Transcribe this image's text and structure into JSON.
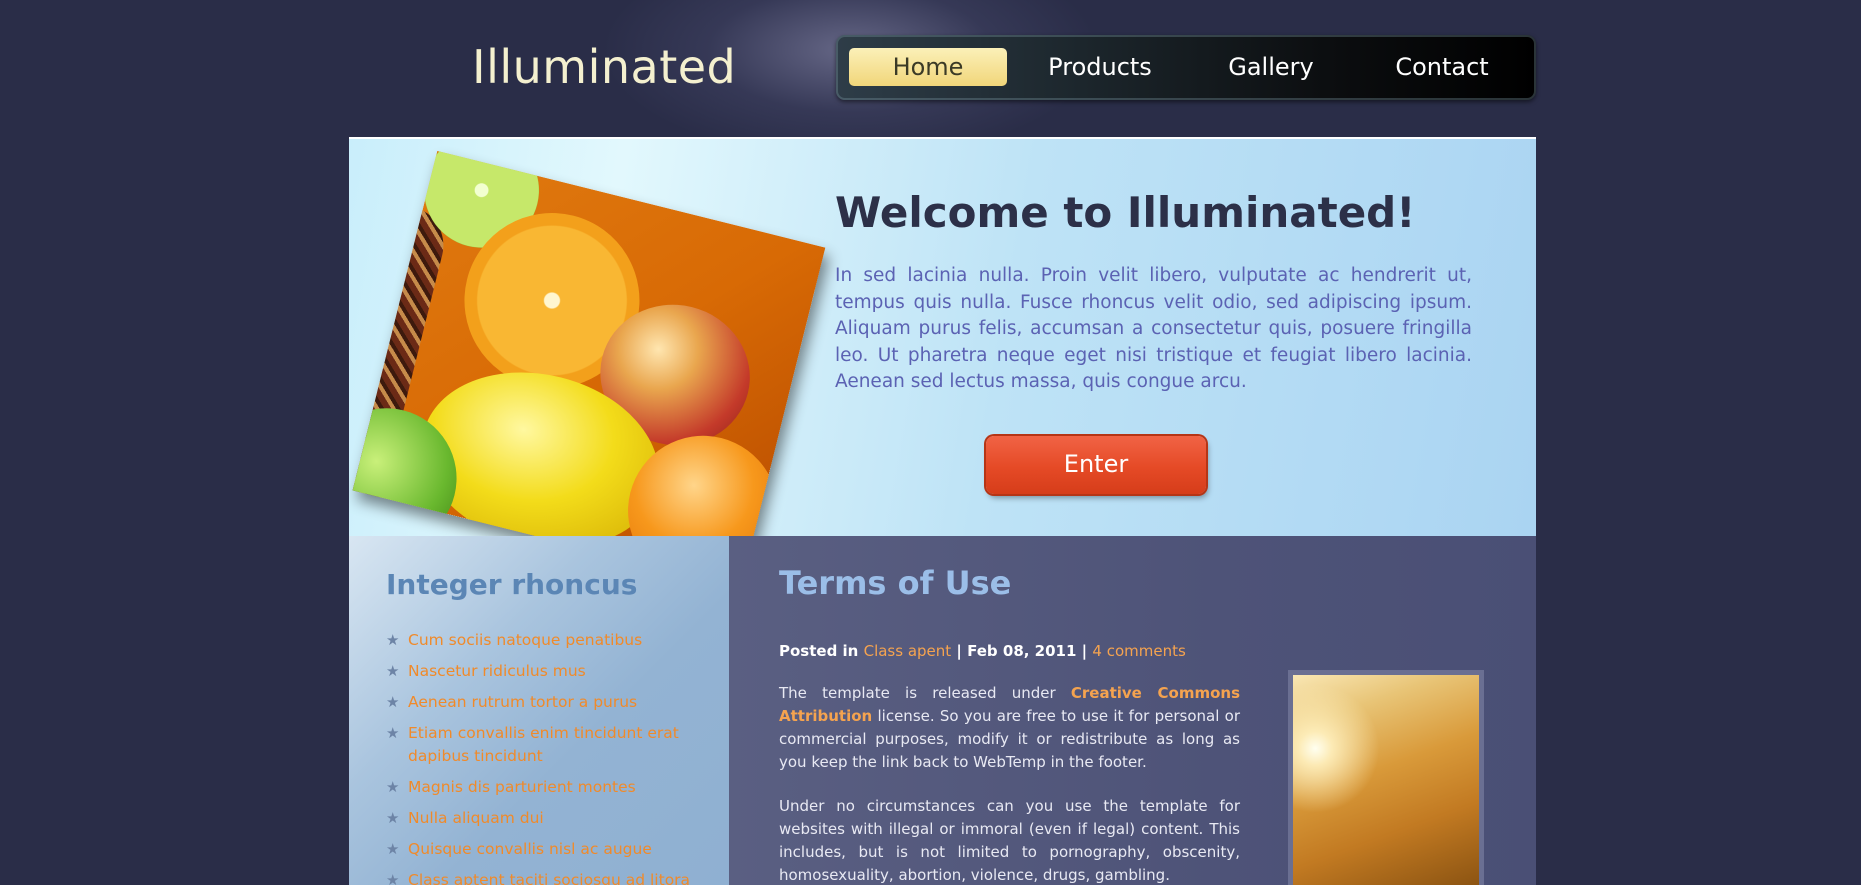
{
  "site": {
    "logo": "Illuminated"
  },
  "nav": {
    "items": [
      {
        "label": "Home",
        "active": true
      },
      {
        "label": "Products",
        "active": false
      },
      {
        "label": "Gallery",
        "active": false
      },
      {
        "label": "Contact",
        "active": false
      }
    ]
  },
  "hero": {
    "title": "Welcome to Illuminated!",
    "text": "In sed lacinia nulla. Proin velit libero, vulputate ac hendrerit ut, tempus quis nulla. Fusce rhoncus velit odio, sed adipiscing ipsum. Aliquam purus felis, accumsan a consectetur quis, posuere fringilla leo. Ut pharetra neque eget nisi tristique et feugiat libero lacinia. Aenean sed lectus massa, quis congue arcu.",
    "button_label": "Enter"
  },
  "sidebar": {
    "title": "Integer rhoncus",
    "items": [
      "Cum sociis natoque penatibus",
      "Nascetur ridiculus mus",
      "Aenean rutrum tortor a purus",
      "Etiam convallis enim tincidunt erat dapibus tincidunt",
      "Magnis dis parturient montes",
      "Nulla aliquam dui",
      "Quisque convallis nisl ac augue",
      "Class aptent taciti sociosqu ad litora"
    ]
  },
  "article": {
    "title": "Terms of Use",
    "meta": {
      "posted_in_label": "Posted in",
      "category": "Class apent",
      "separator": "|",
      "date": "Feb 08, 2011",
      "comments": "4 comments"
    },
    "para1_prefix": "The template is released under",
    "para1_link": "Creative Commons Attribution",
    "para1_suffix": "license. So you are free to use it for personal or commercial purposes, modify it or redistribute as long as you keep the link back to WebTemp in the footer.",
    "para2": "Under no circumstances can you use the template for websites with illegal or immoral (even if legal) content. This includes, but is not limited to pornography, obscenity, homosexuality, abortion, violence, drugs, gambling."
  },
  "colors": {
    "background": "#2a2d48",
    "accent_orange": "#f08a2a",
    "enter_button": "#e54a26",
    "nav_active": "#f1d67a"
  }
}
